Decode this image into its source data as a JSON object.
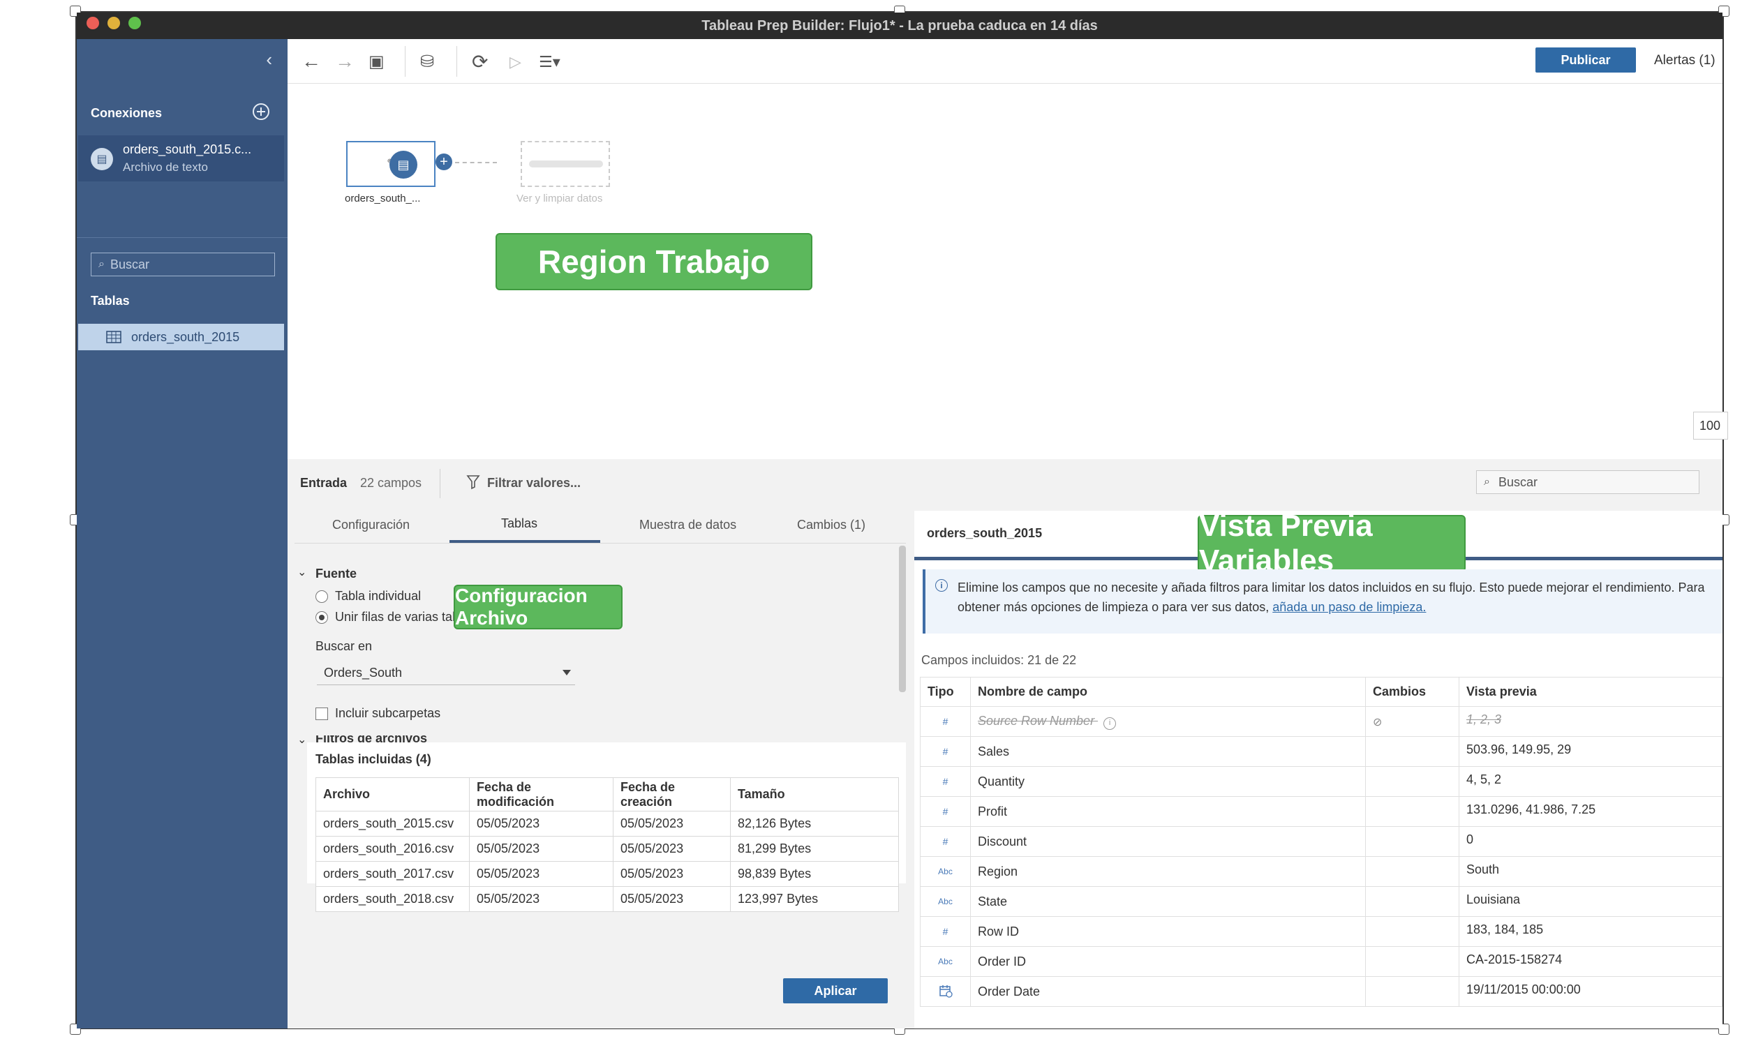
{
  "window": {
    "title": "Tableau Prep Builder: Flujo1* - La prueba caduca en 14 días"
  },
  "sidebar": {
    "connections_title": "Conexiones",
    "connection": {
      "name": "orders_south_2015.c...",
      "type": "Archivo de texto"
    },
    "search_placeholder": "Buscar",
    "tables_title": "Tablas",
    "table_item": "orders_south_2015"
  },
  "toolbar": {
    "publish_label": "Publicar",
    "alerts_label": "Alertas (1)"
  },
  "canvas": {
    "input_node_label": "orders_south_...",
    "ghost_node_label": "Ver y limpiar datos",
    "region_label": "Region Trabajo",
    "zoom": "100"
  },
  "bottom": {
    "entrada_label": "Entrada",
    "campos_label": "22 campos",
    "filter_label": "Filtrar valores...",
    "search_placeholder": "Buscar"
  },
  "left_panel": {
    "tabs": [
      "Configuración",
      "Tablas",
      "Muestra de datos",
      "Cambios (1)"
    ],
    "fuente_label": "Fuente",
    "radio_single": "Tabla individual",
    "radio_union": "Unir filas de varias tablas",
    "search_in_label": "Buscar en",
    "search_in_value": "Orders_South",
    "include_subfolders": "Incluir subcarpetas",
    "file_filters_label": "Filtros de archivos",
    "config_label": "Configuracion Archivo",
    "included_tables_title": "Tablas incluidas (4)",
    "files_headers": [
      "Archivo",
      "Fecha de modificación",
      "Fecha de creación",
      "Tamaño"
    ],
    "files": [
      [
        "orders_south_2015.csv",
        "05/05/2023",
        "05/05/2023",
        "82,126 Bytes"
      ],
      [
        "orders_south_2016.csv",
        "05/05/2023",
        "05/05/2023",
        "81,299 Bytes"
      ],
      [
        "orders_south_2017.csv",
        "05/05/2023",
        "05/05/2023",
        "98,839 Bytes"
      ],
      [
        "orders_south_2018.csv",
        "05/05/2023",
        "05/05/2023",
        "123,997 Bytes"
      ]
    ],
    "apply_label": "Aplicar"
  },
  "right_panel": {
    "title": "orders_south_2015",
    "vars_label": "Vista Previa Variables",
    "info_text": "Elimine los campos que no necesite y añada filtros para limitar los datos incluidos en su flujo. Esto puede mejorar el rendimiento. Para obtener más opciones de limpieza o para ver sus datos,",
    "info_link": "añada un paso de limpieza.",
    "fields_count": "Campos incluidos: 21 de 22",
    "headers": [
      "Tipo",
      "Nombre de campo",
      "Cambios",
      "Vista previa"
    ],
    "rows": [
      {
        "type": "#",
        "name": "Source Row Number",
        "preview": "1, 2, 3",
        "removed": true
      },
      {
        "type": "#",
        "name": "Sales",
        "preview": "503.96, 149.95, 29"
      },
      {
        "type": "#",
        "name": "Quantity",
        "preview": "4, 5, 2"
      },
      {
        "type": "#",
        "name": "Profit",
        "preview": "131.0296, 41.986, 7.25"
      },
      {
        "type": "#",
        "name": "Discount",
        "preview": "0"
      },
      {
        "type": "Abc",
        "name": "Region",
        "preview": "South"
      },
      {
        "type": "Abc",
        "name": "State",
        "preview": "Louisiana"
      },
      {
        "type": "#",
        "name": "Row ID",
        "preview": "183, 184, 185"
      },
      {
        "type": "Abc",
        "name": "Order ID",
        "preview": "CA-2015-158274"
      },
      {
        "type": "date-icon",
        "name": "Order Date",
        "preview": "19/11/2015 00:00:00"
      }
    ]
  }
}
